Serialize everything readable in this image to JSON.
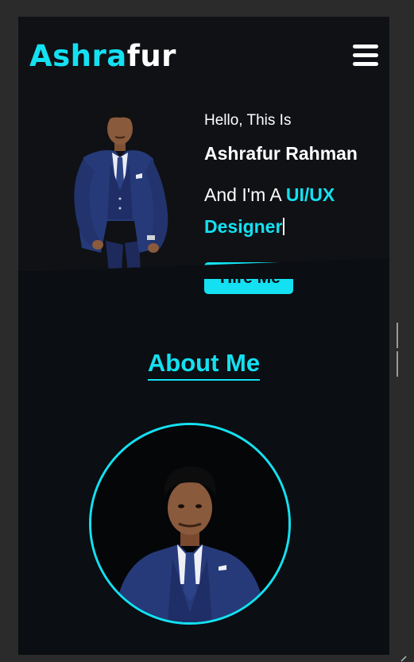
{
  "header": {
    "logo_accent": "Ashra",
    "logo_rest": "fur",
    "menu_icon": "hamburger-menu-icon"
  },
  "hero": {
    "greeting": "Hello, This Is",
    "name": "Ashrafur Rahman",
    "role_prefix": "And I'm A ",
    "role_highlight_1": "UI/UX",
    "role_highlight_2": "Designer",
    "hire_button": "Hire Me"
  },
  "about": {
    "title": "About Me"
  },
  "colors": {
    "accent": "#13e1f2",
    "background": "#0b0e12",
    "header_bg": "#0f1115",
    "text": "#ffffff",
    "outer": "#2b2b2b"
  }
}
